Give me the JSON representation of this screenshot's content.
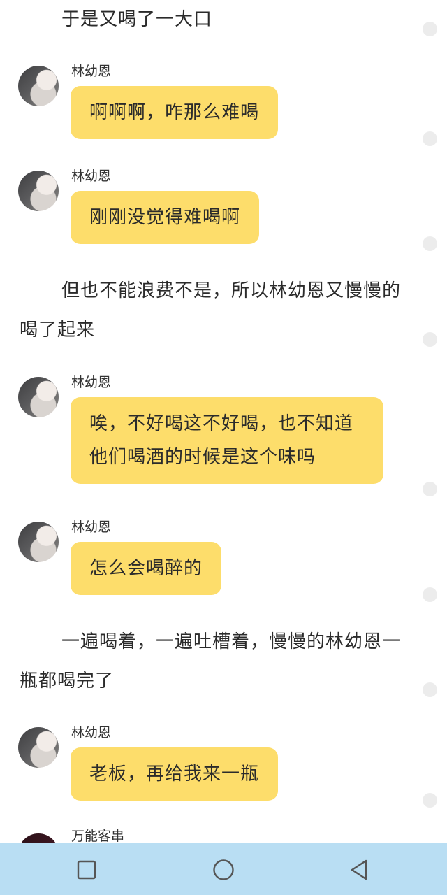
{
  "narration": [
    "于是又喝了一大口",
    "但也不能浪费不是，所以林幼恩又慢慢的喝了起来",
    "一遍喝着，一遍吐槽着，慢慢的林幼恩一瓶都喝完了"
  ],
  "messages": [
    {
      "sender": "林幼恩",
      "text": "啊啊啊，咋那么难喝"
    },
    {
      "sender": "林幼恩",
      "text": "刚刚没觉得难喝啊"
    },
    {
      "sender": "林幼恩",
      "text": "唉，不好喝这不好喝，也不知道他们喝酒的时候是这个味吗"
    },
    {
      "sender": "林幼恩",
      "text": "怎么会喝醉的"
    },
    {
      "sender": "林幼恩",
      "text": "老板，再给我来一瓶"
    },
    {
      "sender": "万能客串",
      "text": ""
    }
  ],
  "colors": {
    "bubble": "#fddd6b",
    "navbar": "#b9def3",
    "text": "#2b2b2b"
  },
  "navigation": {
    "icons": [
      "recent-apps-icon",
      "home-icon",
      "back-icon"
    ]
  }
}
